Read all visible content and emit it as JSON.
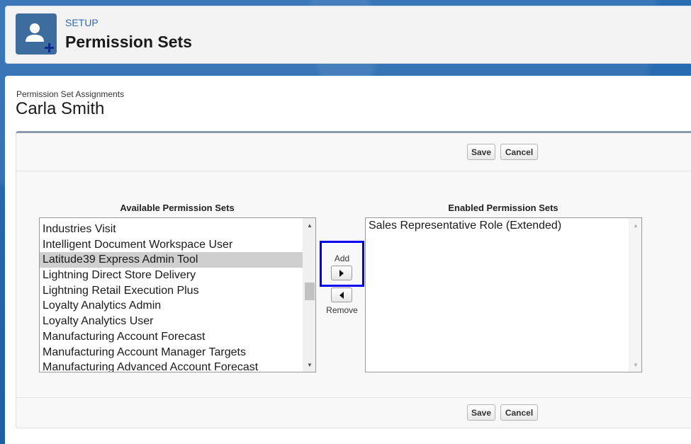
{
  "header": {
    "setup_label": "SETUP",
    "title": "Permission Sets",
    "icon": "user-add-icon"
  },
  "main": {
    "subtitle": "Permission Set Assignments",
    "user_name": "Carla Smith"
  },
  "buttons": {
    "save": "Save",
    "cancel": "Cancel",
    "add": "Add",
    "remove": "Remove"
  },
  "available": {
    "label": "Available Permission Sets",
    "items": [
      "Industries Visit",
      "Intelligent Document Workspace User",
      "Latitude39 Express Admin Tool",
      "Lightning Direct Store Delivery",
      "Lightning Retail Execution Plus",
      "Loyalty Analytics Admin",
      "Loyalty Analytics User",
      "Manufacturing Account Forecast",
      "Manufacturing Account Manager Targets",
      "Manufacturing Advanced Account Forecast"
    ],
    "selected": "Latitude39 Express Admin Tool"
  },
  "enabled": {
    "label": "Enabled Permission Sets",
    "items": [
      "Sales Representative Role (Extended)"
    ]
  },
  "colors": {
    "highlight": "#0000ee",
    "accent": "#2e6ab0"
  }
}
